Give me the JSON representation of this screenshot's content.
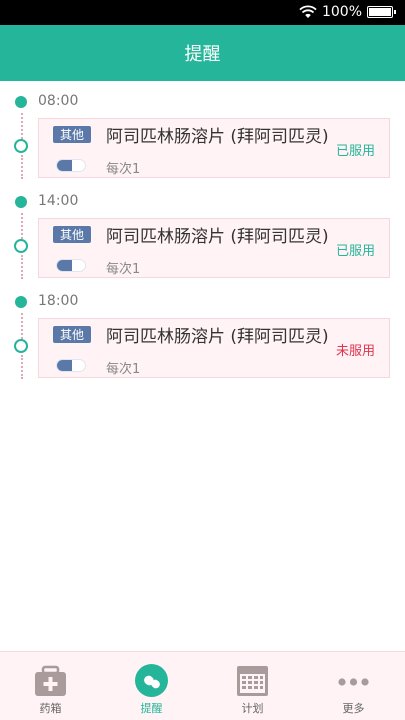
{
  "status_bar": {
    "battery_text": "100%"
  },
  "header": {
    "title": "提醒"
  },
  "schedule": [
    {
      "time": "08:00",
      "tag": "其他",
      "drug": "阿司匹林肠溶片 (拜阿司匹灵)",
      "dose": "每次1",
      "status": "已服用",
      "status_color": "#25b59a"
    },
    {
      "time": "14:00",
      "tag": "其他",
      "drug": "阿司匹林肠溶片 (拜阿司匹灵)",
      "dose": "每次1",
      "status": "已服用",
      "status_color": "#25b59a"
    },
    {
      "time": "18:00",
      "tag": "其他",
      "drug": "阿司匹林肠溶片 (拜阿司匹灵)",
      "dose": "每次1",
      "status": "未服用",
      "status_color": "#e0344e"
    }
  ],
  "tabs": [
    {
      "label": "药箱",
      "icon": "medicine-box-icon"
    },
    {
      "label": "提醒",
      "icon": "pill-reminder-icon",
      "active": true
    },
    {
      "label": "计划",
      "icon": "calendar-icon"
    },
    {
      "label": "更多",
      "icon": "more-icon"
    }
  ],
  "colors": {
    "primary": "#25b59a",
    "tag": "#5b79a8",
    "card_bg": "#fff3f5",
    "missed": "#e0344e"
  }
}
